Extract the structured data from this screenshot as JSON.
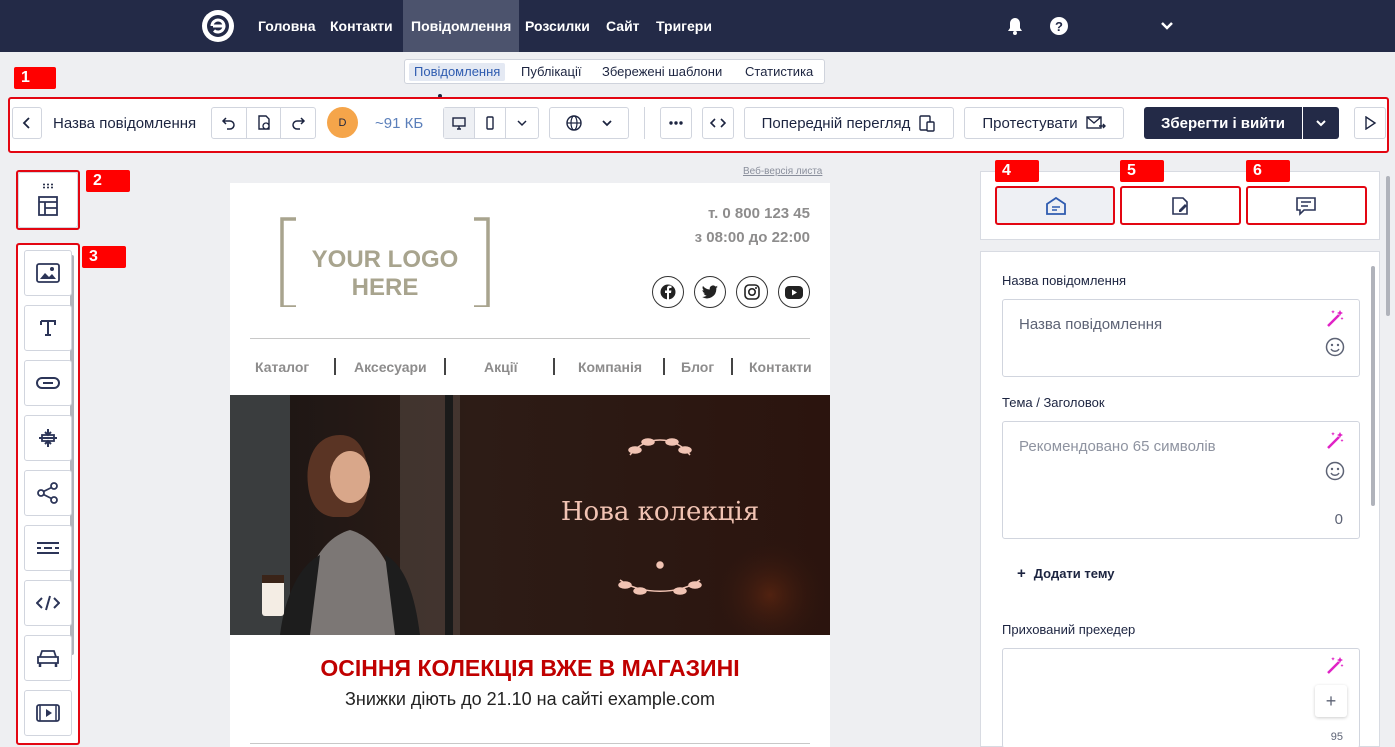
{
  "topnav": {
    "items": [
      "Головна",
      "Контакти",
      "Повідомлення",
      "Розсилки",
      "Сайт",
      "Тригери"
    ],
    "active": "Повідомлення"
  },
  "subtabs": [
    "Повідомлення",
    "Публікації",
    "Збережені шаблони",
    "Статистика"
  ],
  "toolbar": {
    "message_name": "Назва повідомлення",
    "avatar_letter": "D",
    "size": "~91 КБ",
    "preview": "Попередній перегляд",
    "test": "Протестувати",
    "save": "Зберегти і вийти"
  },
  "badges": [
    "1",
    "2",
    "3",
    "4",
    "5",
    "6"
  ],
  "email": {
    "web_version": "Веб-версія листа",
    "logo_text": "YOUR LOGO HERE",
    "phone": "т. 0 800 123 45",
    "hours": "з 08:00 до 22:00",
    "menu": [
      "Каталог",
      "Аксесуари",
      "Акції",
      "Компанія",
      "Блог",
      "Контакти"
    ],
    "banner_title": "Нова колекція",
    "heading": "ОСІННЯ КОЛЕКЦІЯ ВЖЕ В МАГАЗИНІ",
    "subheading": "Знижки діють до 21.10 на сайті example.com"
  },
  "settings": {
    "name_label": "Назва повідомлення",
    "name_value": "Назва повідомлення",
    "subject_label": "Тема / Заголовок",
    "subject_placeholder": "Рекомендовано 65 символів",
    "subject_count": "0",
    "add_subject": "Додати тему",
    "preheader_label": "Прихований прехедер",
    "preheader_count": "95"
  },
  "colors": {
    "nav_bg": "#232a47",
    "accent": "#e30612",
    "save_bg": "#232a47",
    "heading_red": "#c00000",
    "avatar": "#f5a54a",
    "magic": "#e022c5"
  }
}
